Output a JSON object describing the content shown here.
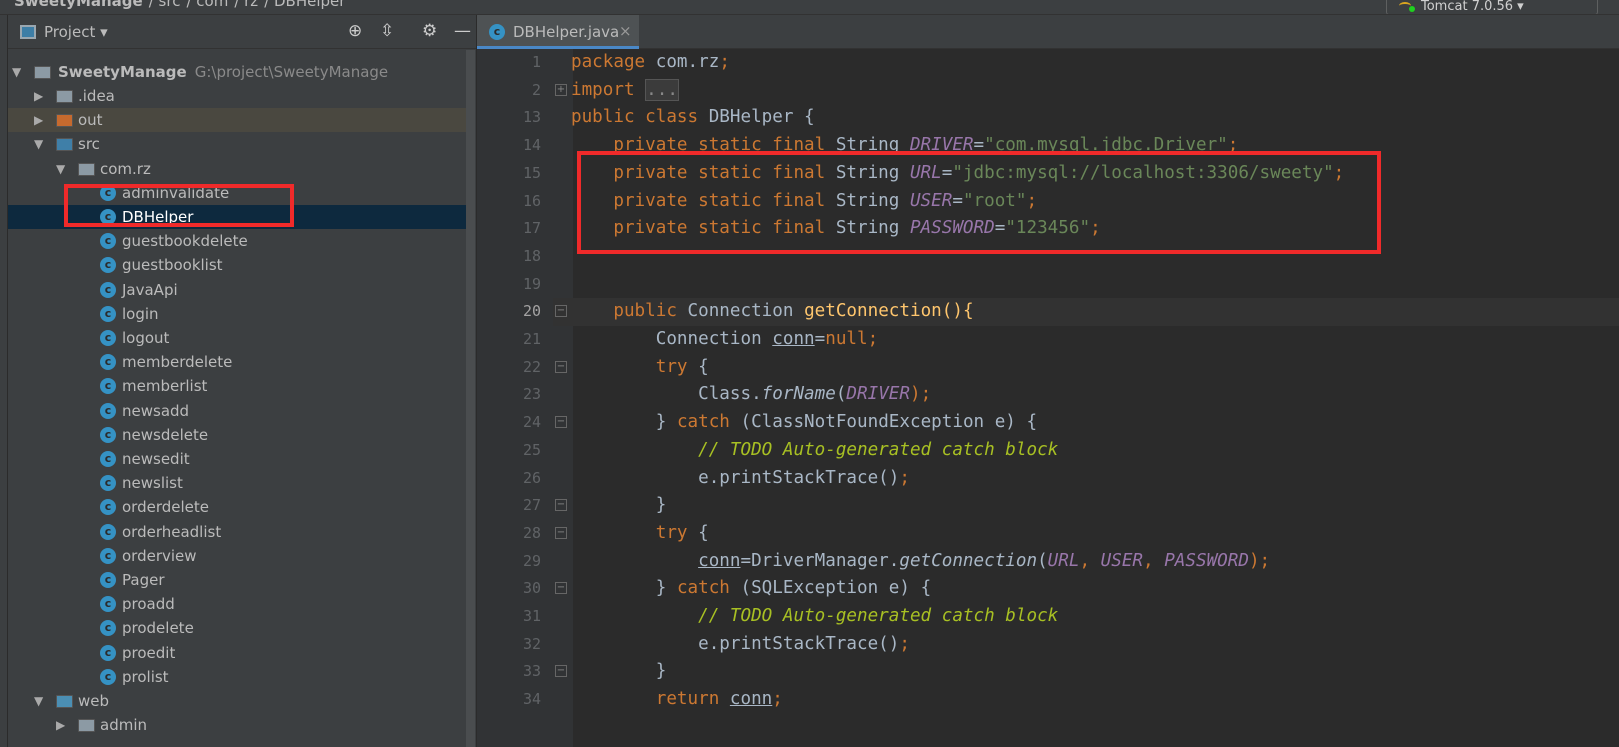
{
  "breadcrumb": [
    "SweetyManage",
    "src",
    "com",
    "rz",
    "DBHelper"
  ],
  "run_config": "Tomcat 7.0.56",
  "project_panel": {
    "title": "Project",
    "root": {
      "name": "SweetyManage",
      "path": "G:\\project\\SweetyManage"
    },
    "items": [
      {
        "label": ".idea",
        "type": "folder",
        "depth": 1,
        "arrow": "right"
      },
      {
        "label": "out",
        "type": "folder-excluded",
        "depth": 1,
        "arrow": "right"
      },
      {
        "label": "src",
        "type": "folder-src",
        "depth": 1,
        "arrow": "down"
      },
      {
        "label": "com.rz",
        "type": "package",
        "depth": 2,
        "arrow": "down"
      },
      {
        "label": "adminvalidate",
        "type": "class",
        "depth": 3
      },
      {
        "label": "DBHelper",
        "type": "class",
        "depth": 3,
        "selected": true
      },
      {
        "label": "guestbookdelete",
        "type": "class",
        "depth": 3
      },
      {
        "label": "guestbooklist",
        "type": "class",
        "depth": 3
      },
      {
        "label": "JavaApi",
        "type": "class",
        "depth": 3
      },
      {
        "label": "login",
        "type": "class",
        "depth": 3
      },
      {
        "label": "logout",
        "type": "class",
        "depth": 3
      },
      {
        "label": "memberdelete",
        "type": "class",
        "depth": 3
      },
      {
        "label": "memberlist",
        "type": "class",
        "depth": 3
      },
      {
        "label": "newsadd",
        "type": "class",
        "depth": 3
      },
      {
        "label": "newsdelete",
        "type": "class",
        "depth": 3
      },
      {
        "label": "newsedit",
        "type": "class",
        "depth": 3
      },
      {
        "label": "newslist",
        "type": "class",
        "depth": 3
      },
      {
        "label": "orderdelete",
        "type": "class",
        "depth": 3
      },
      {
        "label": "orderheadlist",
        "type": "class",
        "depth": 3
      },
      {
        "label": "orderview",
        "type": "class",
        "depth": 3
      },
      {
        "label": "Pager",
        "type": "class",
        "depth": 3
      },
      {
        "label": "proadd",
        "type": "class",
        "depth": 3
      },
      {
        "label": "prodelete",
        "type": "class",
        "depth": 3
      },
      {
        "label": "proedit",
        "type": "class",
        "depth": 3
      },
      {
        "label": "prolist",
        "type": "class",
        "depth": 3
      },
      {
        "label": "web",
        "type": "folder-web",
        "depth": 1,
        "arrow": "down"
      },
      {
        "label": "admin",
        "type": "folder",
        "depth": 2,
        "arrow": "right"
      }
    ]
  },
  "editor": {
    "tab": "DBHelper.java",
    "current_line": "20",
    "lines": [
      {
        "n": "1",
        "t": [
          [
            "package ",
            "k"
          ],
          [
            "com.rz",
            ""
          ],
          [
            ";",
            "k"
          ]
        ]
      },
      {
        "n": "2",
        "t": [
          [
            "import ",
            "k"
          ],
          [
            "...",
            "fold"
          ]
        ]
      },
      {
        "n": "13",
        "t": [
          [
            "public class ",
            "k"
          ],
          [
            "DBHelper {",
            ""
          ]
        ]
      },
      {
        "n": "14",
        "t": [
          [
            "    private static final ",
            "k"
          ],
          [
            "String ",
            ""
          ],
          [
            "DRIVER",
            "c"
          ],
          [
            "=",
            ""
          ],
          [
            "\"com.mysql.jdbc.Driver\"",
            "s"
          ],
          [
            ";",
            "k"
          ]
        ]
      },
      {
        "n": "15",
        "t": [
          [
            "    private static final ",
            "k"
          ],
          [
            "String ",
            ""
          ],
          [
            "URL",
            "c"
          ],
          [
            "=",
            ""
          ],
          [
            "\"jdbc:mysql://localhost:3306/sweety\"",
            "s"
          ],
          [
            ";",
            "k"
          ]
        ]
      },
      {
        "n": "16",
        "t": [
          [
            "    private static final ",
            "k"
          ],
          [
            "String ",
            ""
          ],
          [
            "USER",
            "c"
          ],
          [
            "=",
            ""
          ],
          [
            "\"root\"",
            "s"
          ],
          [
            ";",
            "k"
          ]
        ]
      },
      {
        "n": "17",
        "t": [
          [
            "    private static final ",
            "k"
          ],
          [
            "String ",
            ""
          ],
          [
            "PASSWORD",
            "c"
          ],
          [
            "=",
            ""
          ],
          [
            "\"123456\"",
            "s"
          ],
          [
            ";",
            "k"
          ]
        ]
      },
      {
        "n": "18",
        "t": []
      },
      {
        "n": "19",
        "t": []
      },
      {
        "n": "20",
        "t": [
          [
            "    public ",
            "k"
          ],
          [
            "Connection ",
            ""
          ],
          [
            "getConnection",
            "m"
          ],
          [
            "(){",
            "m"
          ]
        ]
      },
      {
        "n": "21",
        "t": [
          [
            "        Connection ",
            ""
          ],
          [
            "conn",
            "u"
          ],
          [
            "=",
            ""
          ],
          [
            "null",
            "k"
          ],
          [
            ";",
            "k"
          ]
        ]
      },
      {
        "n": "22",
        "t": [
          [
            "        try ",
            "k"
          ],
          [
            "{",
            ""
          ]
        ]
      },
      {
        "n": "23",
        "t": [
          [
            "            Class.",
            ""
          ],
          [
            "forName",
            "ci"
          ],
          [
            "(",
            ""
          ],
          [
            "DRIVER",
            "c"
          ],
          [
            ");",
            "k"
          ]
        ]
      },
      {
        "n": "24",
        "t": [
          [
            "        } ",
            ""
          ],
          [
            "catch ",
            "k"
          ],
          [
            "(ClassNotFoundException e) {",
            ""
          ]
        ]
      },
      {
        "n": "25",
        "t": [
          [
            "            // ",
            "todo"
          ],
          [
            "TODO Auto-generated catch block",
            "todo"
          ]
        ]
      },
      {
        "n": "26",
        "t": [
          [
            "            e.printStackTrace()",
            ""
          ],
          [
            ";",
            "k"
          ]
        ]
      },
      {
        "n": "27",
        "t": [
          [
            "        }",
            ""
          ]
        ]
      },
      {
        "n": "28",
        "t": [
          [
            "        try ",
            "k"
          ],
          [
            "{",
            ""
          ]
        ]
      },
      {
        "n": "29",
        "t": [
          [
            "            ",
            ""
          ],
          [
            "conn",
            "u"
          ],
          [
            "=DriverManager.",
            ""
          ],
          [
            "getConnection",
            "ci"
          ],
          [
            "(",
            ""
          ],
          [
            "URL",
            "c"
          ],
          [
            ", ",
            "k"
          ],
          [
            "USER",
            "c"
          ],
          [
            ", ",
            "k"
          ],
          [
            "PASSWORD",
            "c"
          ],
          [
            ");",
            "k"
          ]
        ]
      },
      {
        "n": "30",
        "t": [
          [
            "        } ",
            ""
          ],
          [
            "catch ",
            "k"
          ],
          [
            "(SQLException e) {",
            ""
          ]
        ]
      },
      {
        "n": "31",
        "t": [
          [
            "            // ",
            "todo"
          ],
          [
            "TODO Auto-generated catch block",
            "todo"
          ]
        ]
      },
      {
        "n": "32",
        "t": [
          [
            "            e.printStackTrace()",
            ""
          ],
          [
            ";",
            "k"
          ]
        ]
      },
      {
        "n": "33",
        "t": [
          [
            "        }",
            ""
          ]
        ]
      },
      {
        "n": "34",
        "t": [
          [
            "        return ",
            "k"
          ],
          [
            "conn",
            "u"
          ],
          [
            ";",
            "k"
          ]
        ]
      }
    ]
  },
  "colors": {
    "highlight_box": "#f02a2a",
    "keyword": "#cc7832",
    "string": "#6a8759",
    "constant": "#9876aa",
    "method": "#ffc66d",
    "selection": "#0d293e"
  }
}
